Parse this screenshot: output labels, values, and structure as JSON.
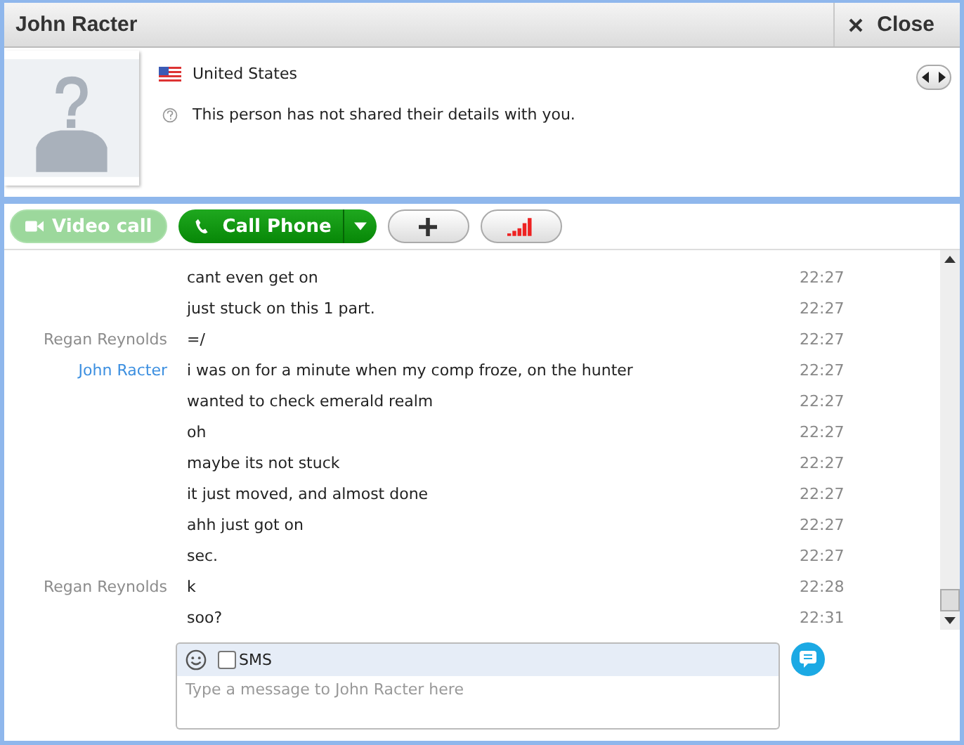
{
  "window": {
    "title": "John Racter",
    "close_label": "Close"
  },
  "profile": {
    "country": "United States",
    "notice": "This person has not shared their details with you."
  },
  "toolbar": {
    "video_call": {
      "label": "Video call",
      "disabled": true
    },
    "call_phone": {
      "label": "Call Phone"
    }
  },
  "messages": [
    {
      "text": "cant even get on",
      "time": "22:27"
    },
    {
      "text": "just stuck on this 1 part.",
      "time": "22:27"
    },
    {
      "sender": "Regan Reynolds",
      "color": "#8c8c8c",
      "text": "=/",
      "time": "22:27"
    },
    {
      "sender": "John Racter",
      "color": "#3c8fe0",
      "text": "i was on for a minute when my comp froze, on the hunter",
      "time": "22:27"
    },
    {
      "text": "wanted to check emerald realm",
      "time": "22:27"
    },
    {
      "text": "oh",
      "time": "22:27"
    },
    {
      "text": "maybe its not stuck",
      "time": "22:27"
    },
    {
      "text": "it just moved, and almost done",
      "time": "22:27"
    },
    {
      "text": "ahh just got on",
      "time": "22:27"
    },
    {
      "text": "sec.",
      "time": "22:27"
    },
    {
      "sender": "Regan Reynolds",
      "color": "#8c8c8c",
      "text": "k",
      "time": "22:28"
    },
    {
      "text": "soo?",
      "time": "22:31"
    }
  ],
  "composer": {
    "sms_label": "SMS",
    "sms_checked": false,
    "placeholder": "Type a message to John Racter here"
  }
}
